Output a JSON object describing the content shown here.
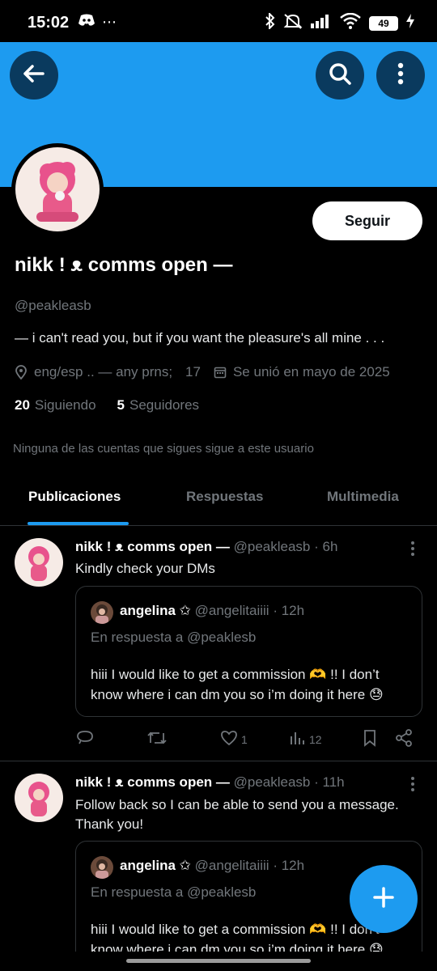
{
  "status_bar": {
    "time": "15:02",
    "battery": "49"
  },
  "profile": {
    "display_name": "nikk ! ᴥ comms open —",
    "handle": "@peakleasb",
    "bio": "— i can't read you, but if you want the pleasure's all mine . . .",
    "location": "eng/esp .. — any prns;",
    "age": "17",
    "joined": "Se unió en mayo de 2025",
    "following_count": "20",
    "following_label": "Siguiendo",
    "followers_count": "5",
    "followers_label": "Seguidores",
    "follow_button": "Seguir",
    "followed_note": "Ninguna de las cuentas que sigues sigue a este usuario"
  },
  "tabs": [
    {
      "label": "Publicaciones",
      "active": true
    },
    {
      "label": "Respuestas",
      "active": false
    },
    {
      "label": "Multimedia",
      "active": false
    }
  ],
  "posts": [
    {
      "name": "nikk ! ᴥ comms open —",
      "handle": "@peakleasb",
      "time": "· 6h",
      "text": "Kindly check your DMs",
      "quote": {
        "name": "angelina ✩",
        "handle": "@angelitaiiii",
        "time": "· 12h",
        "reply_to": "En respuesta a @peaklesb",
        "text": "hiii I would like to get a commission 🫶 !! I don’t know where i can dm you so i’m doing it here 😓"
      },
      "likes": "1",
      "views": "12"
    },
    {
      "name": "nikk ! ᴥ comms open —",
      "handle": "@peakleasb",
      "time": "· 11h",
      "text": "Follow back so I can be able to send you a message. Thank you!",
      "quote": {
        "name": "angelina ✩",
        "handle": "@angelitaiiii",
        "time": "· 12h",
        "reply_to": "En respuesta a @peaklesb",
        "text": "hiii I would like to get a commission 🫶 !! I don’t know where i can dm you so i’m doing it here 😓"
      }
    }
  ],
  "colors": {
    "accent": "#1d9bf0",
    "background": "#000000",
    "muted": "#71767b",
    "border": "#2f3336"
  }
}
